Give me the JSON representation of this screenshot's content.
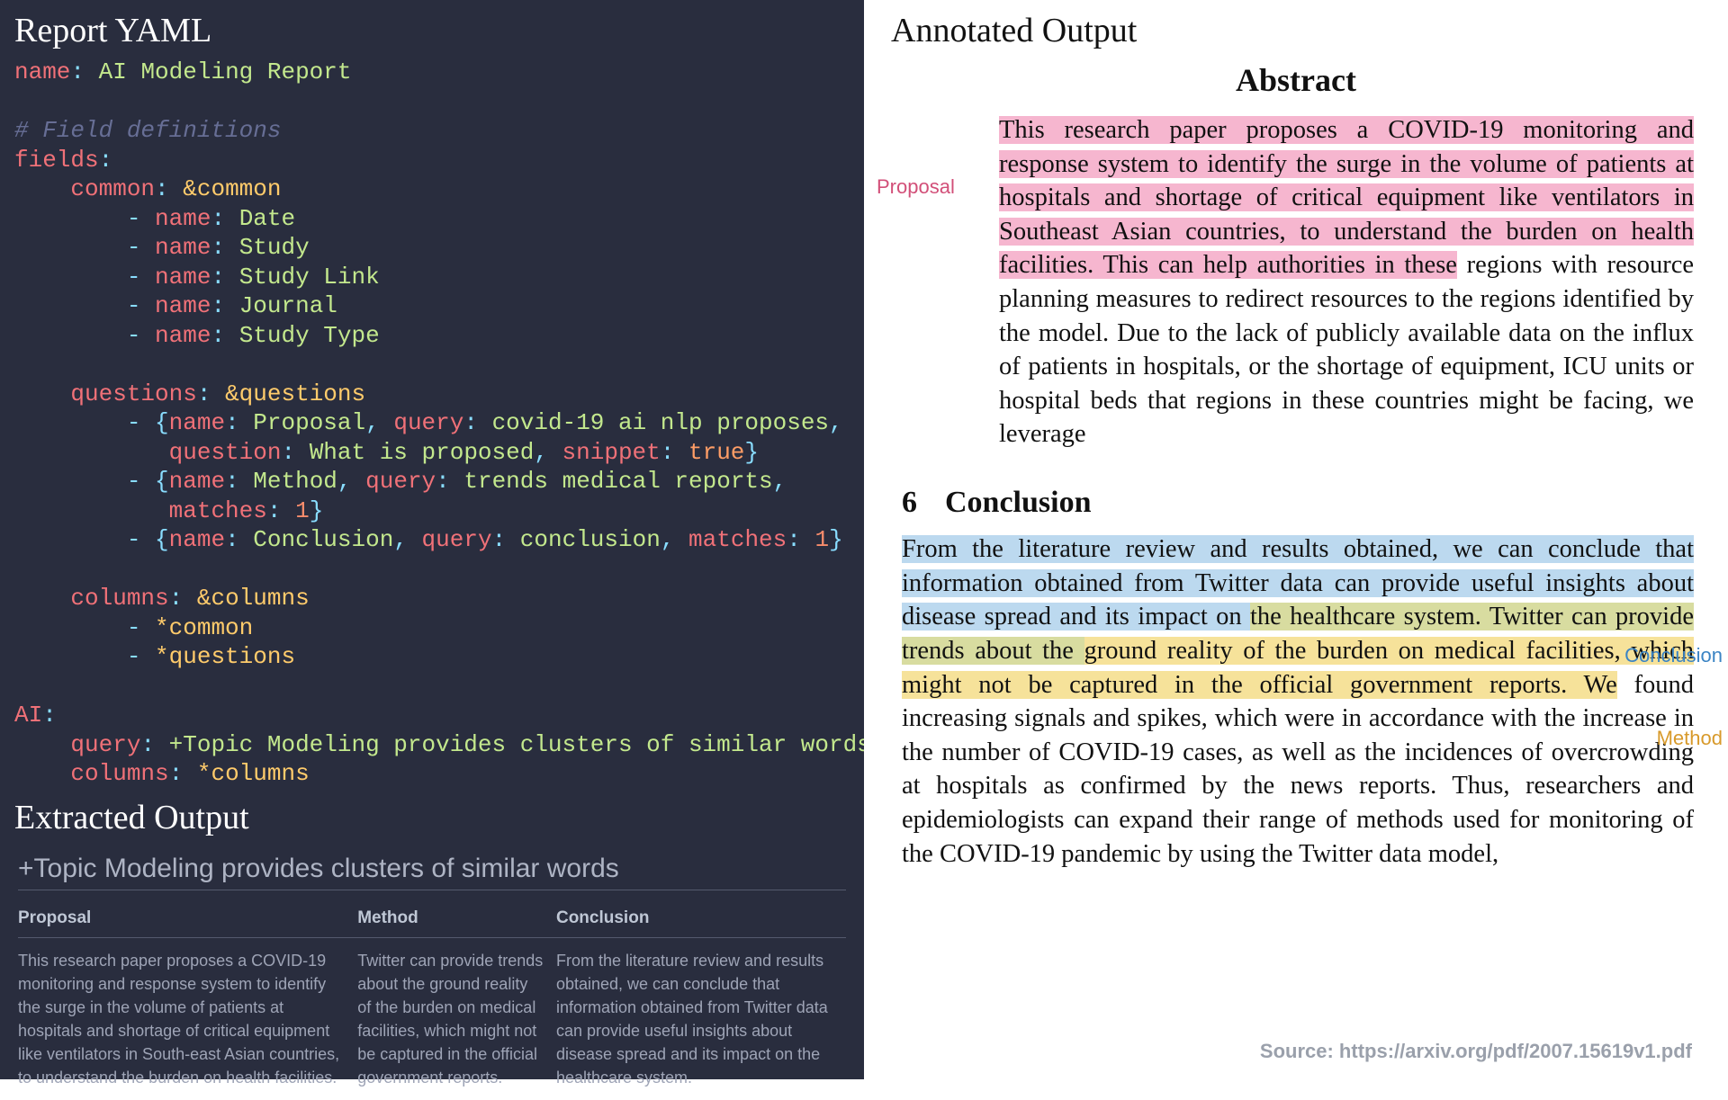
{
  "left": {
    "title": "Report YAML",
    "yaml": {
      "name_key": "name",
      "name_val": "AI Modeling Report",
      "comment": "# Field definitions",
      "fields_key": "fields",
      "common_key": "common",
      "common_anchor": "&common",
      "common_items": [
        "Date",
        "Study",
        "Study Link",
        "Journal",
        "Study Type"
      ],
      "questions_key": "questions",
      "questions_anchor": "&questions",
      "q1": {
        "name": "Proposal",
        "query": "covid-19 ai nlp proposes",
        "question": "What is proposed",
        "snippet": "true"
      },
      "q2": {
        "name": "Method",
        "query": "trends medical reports",
        "matches": "1"
      },
      "q3": {
        "name": "Conclusion",
        "query": "conclusion",
        "matches": "1"
      },
      "columns_key": "columns",
      "columns_anchor": "&columns",
      "columns_refs": [
        "*common",
        "*questions"
      ],
      "ai_key": "AI",
      "ai_query_key": "query",
      "ai_query_val": "+Topic Modeling provides clusters of similar words",
      "ai_columns_key": "columns",
      "ai_columns_val": "*columns",
      "kw_name": "name",
      "kw_query": "query",
      "kw_question": "question",
      "kw_snippet": "snippet",
      "kw_matches": "matches"
    },
    "extracted_title": "Extracted Output",
    "extracted_heading": "+Topic Modeling provides clusters of similar words",
    "table": {
      "h1": "Proposal",
      "h2": "Method",
      "h3": "Conclusion",
      "c1": "This research paper proposes a COVID-19 monitoring and response system to identify the surge in the volume of patients at hospitals and shortage of critical equipment like ventilators in South-east Asian countries, to understand the burden on health facilities.",
      "c2": "Twitter can provide trends about the ground reality of the burden on medical facilities, which might not be captured in the official government reports.",
      "c3": "From the literature review and results obtained, we can conclude that information obtained from Twitter data can provide useful insights about disease spread and its impact on the healthcare system."
    }
  },
  "right": {
    "title": "Annotated Output",
    "abstract_heading": "Abstract",
    "label_proposal": "Proposal",
    "abstract_hl": "This research paper proposes a COVID-19 monitoring and response system to identify the surge in the volume of patients at hospitals and shortage of critical equipment like ventilators in Southeast Asian countries, to understand the burden on health facilities. This can help authorities in these",
    "abstract_rest": " regions with resource planning measures to redirect resources to the regions identified by the model. Due to the lack of publicly available data on the influx of patients in hospitals, or the shortage of equipment, ICU units or hospital beds that regions in these countries might be facing, we leverage",
    "sec_num": "6",
    "sec_title": "Conclusion",
    "label_conclusion": "Conclusion",
    "label_method": "Method",
    "concl_blue": "From the literature review and results obtained, we can conclude that information obtained from Twitter data can provide useful insights about disease spread and its impact on ",
    "concl_olive": "the healthcare system. Twitter can provide trends about the ",
    "concl_yellow": "ground reality of the burden on medical facilities, which might not be captured in the official government reports. We",
    "concl_rest": " found increasing signals and spikes, which were in accordance with the increase in the number of COVID-19 cases, as well as the incidences of overcrowding at hospitals as confirmed by the news reports. Thus, researchers and epidemiologists can expand their range of methods used for monitoring of the COVID-19 pandemic by using the Twitter data model,",
    "source": "Source: https://arxiv.org/pdf/2007.15619v1.pdf"
  }
}
